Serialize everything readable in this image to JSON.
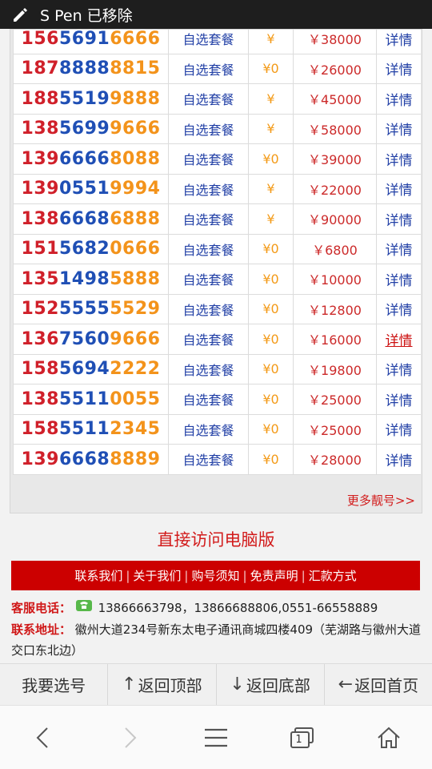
{
  "status_bar": {
    "notification": "S Pen 已移除"
  },
  "numbers": [
    {
      "a": "156",
      "b": "5691",
      "c": "6666",
      "plan": "自选套餐",
      "fee": "¥",
      "price": "￥38000",
      "detail": "详情"
    },
    {
      "a": "187",
      "b": "8888",
      "c": "8815",
      "plan": "自选套餐",
      "fee": "¥0",
      "price": "￥26000",
      "detail": "详情"
    },
    {
      "a": "188",
      "b": "5519",
      "c": "9888",
      "plan": "自选套餐",
      "fee": "¥",
      "price": "￥45000",
      "detail": "详情"
    },
    {
      "a": "138",
      "b": "5699",
      "c": "9666",
      "plan": "自选套餐",
      "fee": "¥",
      "price": "￥58000",
      "detail": "详情"
    },
    {
      "a": "139",
      "b": "6666",
      "c": "8088",
      "plan": "自选套餐",
      "fee": "¥0",
      "price": "￥39000",
      "detail": "详情"
    },
    {
      "a": "139",
      "b": "0551",
      "c": "9994",
      "plan": "自选套餐",
      "fee": "¥",
      "price": "￥22000",
      "detail": "详情"
    },
    {
      "a": "138",
      "b": "6668",
      "c": "6888",
      "plan": "自选套餐",
      "fee": "¥",
      "price": "￥90000",
      "detail": "详情"
    },
    {
      "a": "151",
      "b": "5682",
      "c": "0666",
      "plan": "自选套餐",
      "fee": "¥0",
      "price": "￥6800",
      "detail": "详情"
    },
    {
      "a": "135",
      "b": "1498",
      "c": "5888",
      "plan": "自选套餐",
      "fee": "¥0",
      "price": "￥10000",
      "detail": "详情"
    },
    {
      "a": "152",
      "b": "5555",
      "c": "5529",
      "plan": "自选套餐",
      "fee": "¥0",
      "price": "￥12800",
      "detail": "详情"
    },
    {
      "a": "136",
      "b": "7560",
      "c": "9666",
      "plan": "自选套餐",
      "fee": "¥0",
      "price": "￥16000",
      "detail": "详情",
      "active": true
    },
    {
      "a": "158",
      "b": "5694",
      "c": "2222",
      "plan": "自选套餐",
      "fee": "¥0",
      "price": "￥19800",
      "detail": "详情"
    },
    {
      "a": "138",
      "b": "5511",
      "c": "0055",
      "plan": "自选套餐",
      "fee": "¥0",
      "price": "￥25000",
      "detail": "详情"
    },
    {
      "a": "158",
      "b": "5511",
      "c": "2345",
      "plan": "自选套餐",
      "fee": "¥0",
      "price": "￥25000",
      "detail": "详情"
    },
    {
      "a": "139",
      "b": "6668",
      "c": "8889",
      "plan": "自选套餐",
      "fee": "¥0",
      "price": "￥28000",
      "detail": "详情"
    }
  ],
  "more_link": "更多靓号>>",
  "pc_version": "直接访问电脑版",
  "footer_nav": [
    "联系我们",
    "关于我们",
    "购号须知",
    "免责声明",
    "汇款方式"
  ],
  "contact": {
    "phone_label": "客服电话：",
    "phone_value": "13866663798，13866688806,0551-66558889",
    "address_label": "联系地址：",
    "address_value": "徽州大道234号新东太电子通讯商城四楼409（芜湖路与徽州大道交口东北边）"
  },
  "bottom_bar": {
    "select": "我要选号",
    "top": "返回顶部",
    "bottom": "返回底部",
    "home": "返回首页"
  },
  "browser_bar": {
    "tab_count": "1"
  },
  "colors": {
    "accent_red": "#cc0000",
    "digit_red": "#d0202a",
    "digit_blue": "#1f4fb5",
    "digit_orange": "#f3931b"
  }
}
